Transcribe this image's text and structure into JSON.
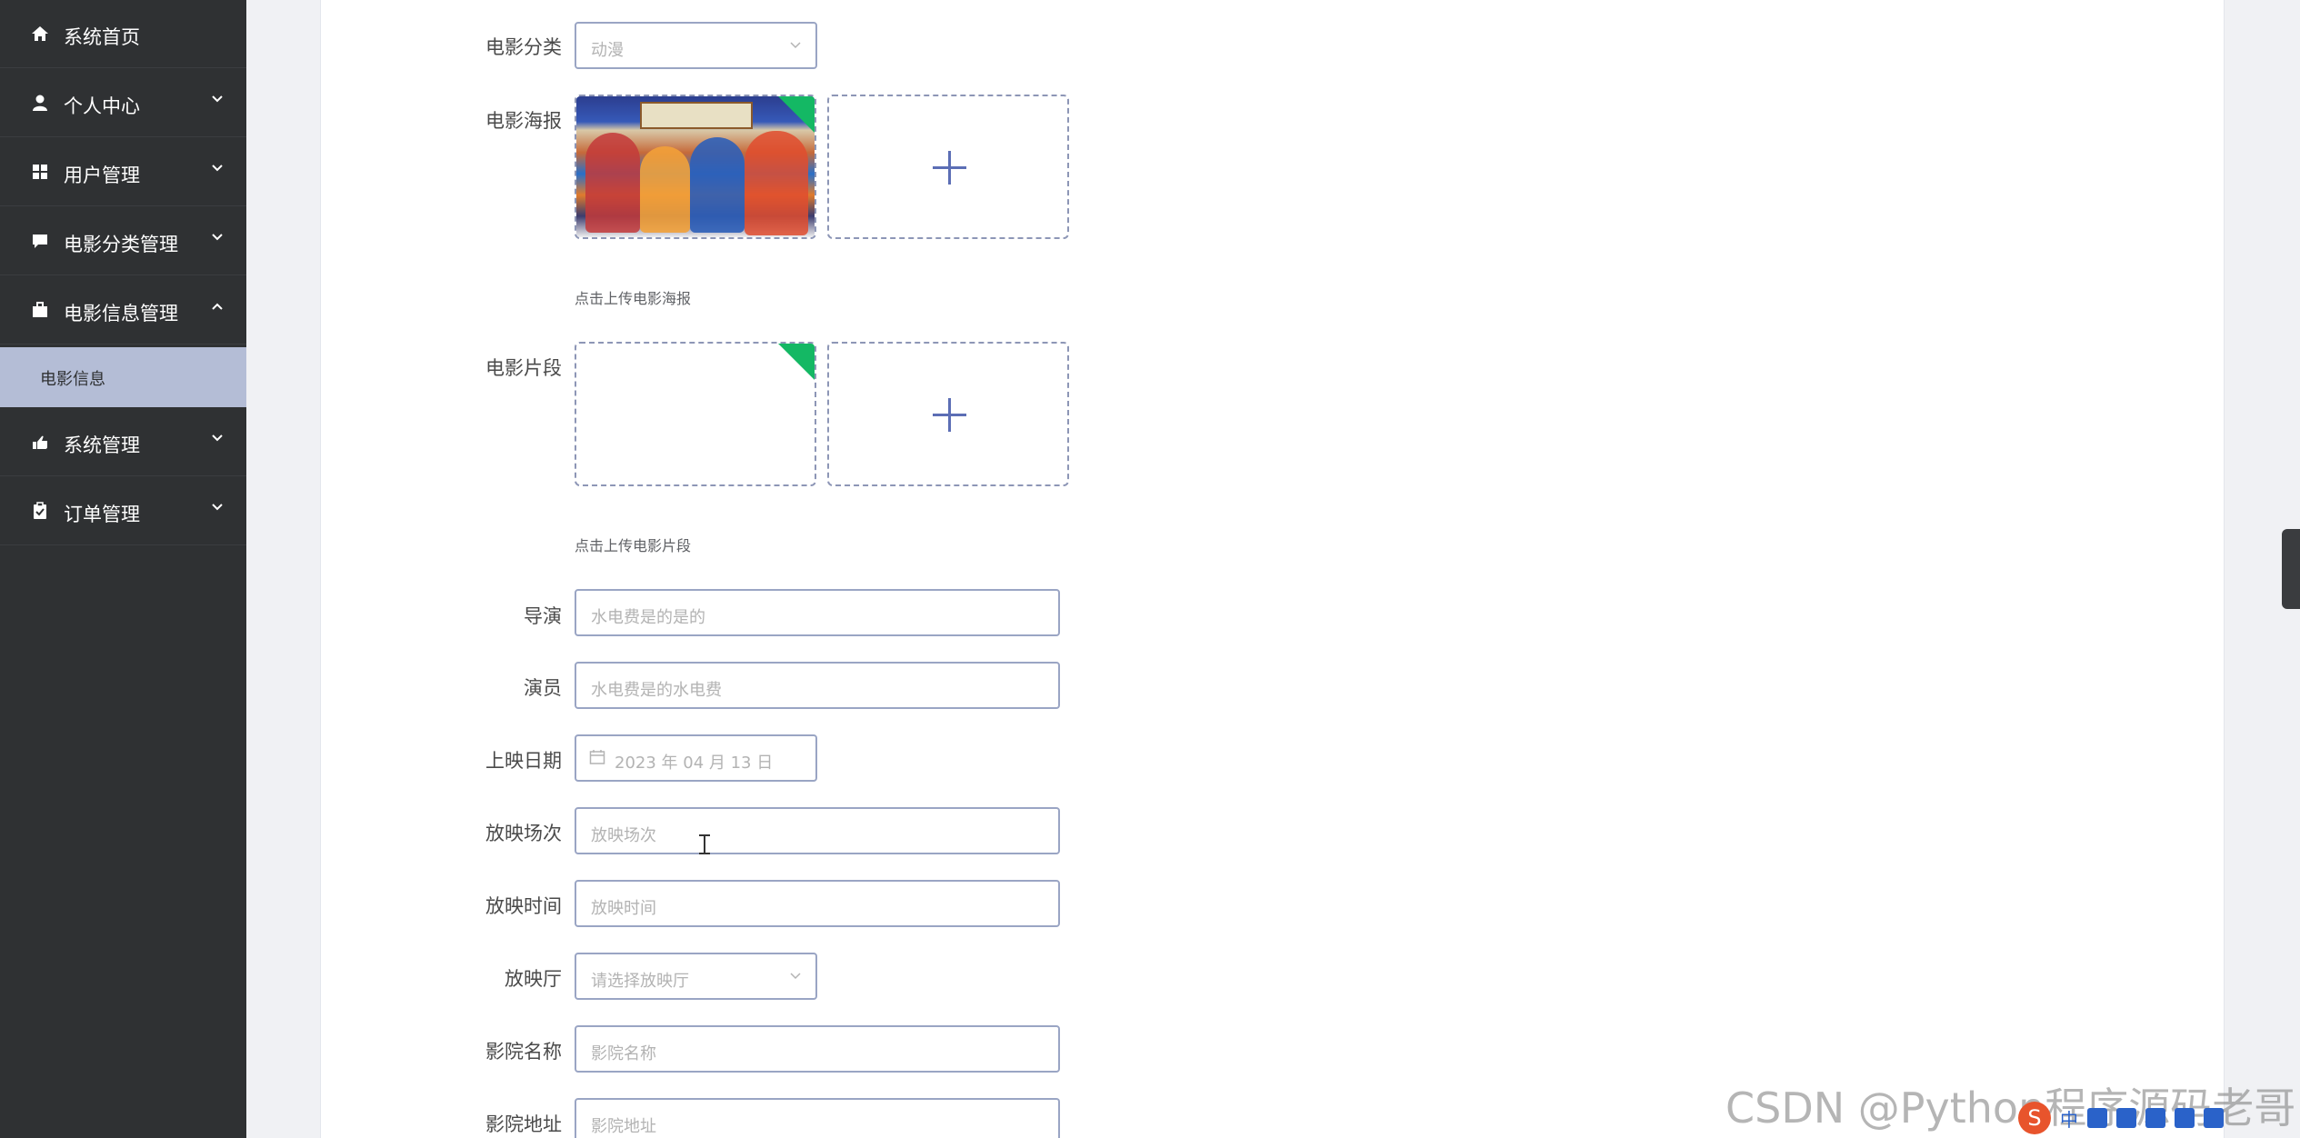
{
  "sidebar": {
    "items": [
      {
        "label": "系统首页",
        "icon": "home-icon"
      },
      {
        "label": "个人中心",
        "icon": "user-icon"
      },
      {
        "label": "用户管理",
        "icon": "grid-icon"
      },
      {
        "label": "电影分类管理",
        "icon": "chat-icon"
      },
      {
        "label": "电影信息管理",
        "icon": "briefcase-icon",
        "expanded": true
      },
      {
        "label": "系统管理",
        "icon": "hand-icon"
      },
      {
        "label": "订单管理",
        "icon": "clipboard-icon"
      }
    ],
    "submenu": {
      "label": "电影信息"
    },
    "colors": {
      "background": "#2f3133",
      "submenu_bg": "#b4bdd6"
    }
  },
  "form": {
    "category": {
      "label": "电影分类",
      "value": "动漫"
    },
    "poster": {
      "label": "电影海报",
      "hint": "点击上传电影海报"
    },
    "clip": {
      "label": "电影片段",
      "hint": "点击上传电影片段"
    },
    "director": {
      "label": "导演",
      "value": "水电费是的是的"
    },
    "actors": {
      "label": "演员",
      "value": "水电费是的水电费"
    },
    "release_date": {
      "label": "上映日期",
      "value": "2023 年 04 月 13 日"
    },
    "screening": {
      "label": "放映场次",
      "placeholder": "放映场次"
    },
    "show_time": {
      "label": "放映时间",
      "placeholder": "放映时间"
    },
    "hall": {
      "label": "放映厅",
      "placeholder": "请选择放映厅"
    },
    "cinema_name": {
      "label": "影院名称",
      "placeholder": "影院名称"
    },
    "cinema_address": {
      "label": "影院地址",
      "placeholder": "影院地址"
    }
  },
  "watermark": "CSDN @Python程序源码老哥",
  "tray": {
    "ime_logo": "S",
    "ime_mode": "中"
  }
}
